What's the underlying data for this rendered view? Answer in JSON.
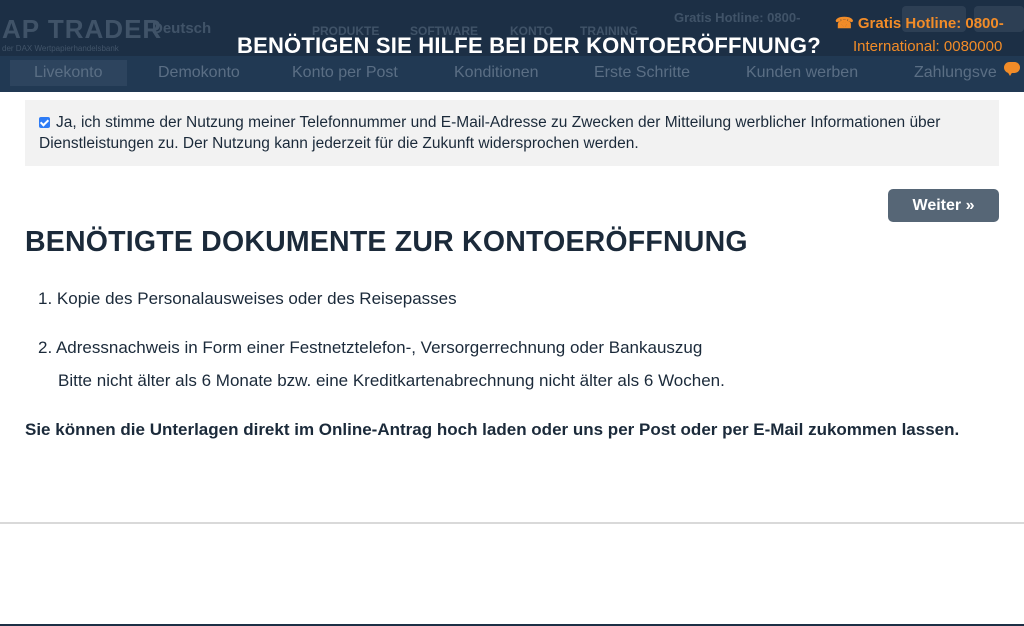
{
  "background_header": {
    "logo": "AP TRADER",
    "logo_sub": "der DAX Wertpapierhandelsbank",
    "language": "Deutsch",
    "menu": [
      "PRODUKTE",
      "SOFTWARE",
      "KONTO",
      "TRAINING"
    ],
    "gratis_short": "Gratis Hotline: 0800-",
    "subnav": [
      "Livekonto",
      "Demokonto",
      "Konto per Post",
      "Konditionen",
      "Erste Schritte",
      "Kunden werben",
      "Zahlungsve"
    ]
  },
  "overlay": {
    "title": "BENÖTIGEN SIE HILFE BEI DER KONTOERÖFFNUNG?",
    "hotline": "☎ Gratis Hotline: 0800-",
    "international": "International: 0080000"
  },
  "consent": {
    "checked": true,
    "text": "Ja, ich stimme der Nutzung meiner Telefonnummer und E-Mail-Adresse zu Zwecken der Mitteilung werblicher Informationen über Dienstleistungen zu. Der Nutzung kann jederzeit für die Zukunft widersprochen werden."
  },
  "buttons": {
    "weiter": "Weiter »"
  },
  "documents": {
    "heading": "BENÖTIGTE DOKUMENTE ZUR KONTOERÖFFNUNG",
    "items": [
      "1. Kopie des Personalausweises oder des Reisepasses",
      "2. Adressnachweis in Form einer Festnetztelefon-, Versorgerrechnung oder Bankauszug"
    ],
    "item2_note": "Bitte nicht älter als 6 Monate bzw. eine Kreditkartenabrechnung nicht älter als 6 Wochen.",
    "upload_note": "Sie können die Unterlagen direkt im Online-Antrag hoch laden oder uns per Post oder per E-Mail zukommen lassen."
  },
  "colors": {
    "header_bg": "#1c2f45",
    "accent_orange": "#f28c28",
    "button_bg": "#566676",
    "text_dark": "#1b2a3a"
  }
}
